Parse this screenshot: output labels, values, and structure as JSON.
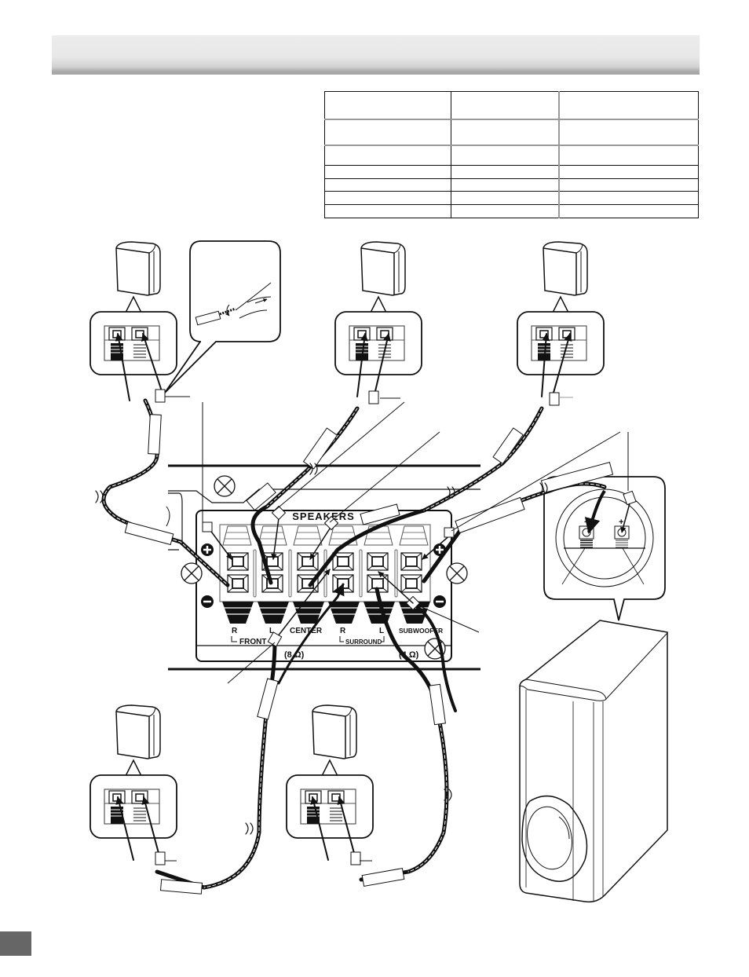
{
  "header": {
    "title": ""
  },
  "spec_table": {
    "columns": [
      "",
      "",
      ""
    ],
    "rows": [
      [
        "",
        "",
        ""
      ],
      [
        "",
        "",
        ""
      ],
      [
        "",
        "",
        ""
      ],
      [
        "",
        "",
        ""
      ],
      [
        "",
        "",
        ""
      ],
      [
        "",
        "",
        ""
      ]
    ]
  },
  "panel": {
    "title": "SPEAKERS",
    "plus_symbol": "+",
    "minus_symbol": "−",
    "labels": {
      "front_r": "R",
      "front_l": "L",
      "front": "FRONT",
      "center": "CENTER",
      "surround_r": "R",
      "surround_l": "L",
      "surround": "SURROUND",
      "subwoofer": "SUBWOOFER",
      "impedance_main": "(8 Ω)",
      "impedance_sub": "(4 Ω)"
    }
  },
  "subwoofer_terminal": {
    "minus": "−",
    "plus": "+"
  },
  "speakers": [
    {
      "id": "front-right",
      "position": "top-left"
    },
    {
      "id": "center",
      "position": "top-middle"
    },
    {
      "id": "front-left",
      "position": "top-right"
    },
    {
      "id": "surround-right",
      "position": "bottom-left"
    },
    {
      "id": "surround-left",
      "position": "bottom-middle"
    },
    {
      "id": "subwoofer",
      "position": "bottom-right"
    }
  ],
  "colors": {
    "header_bar": "#e8e8e8",
    "page_tab": "#666666",
    "line": "#111111"
  }
}
